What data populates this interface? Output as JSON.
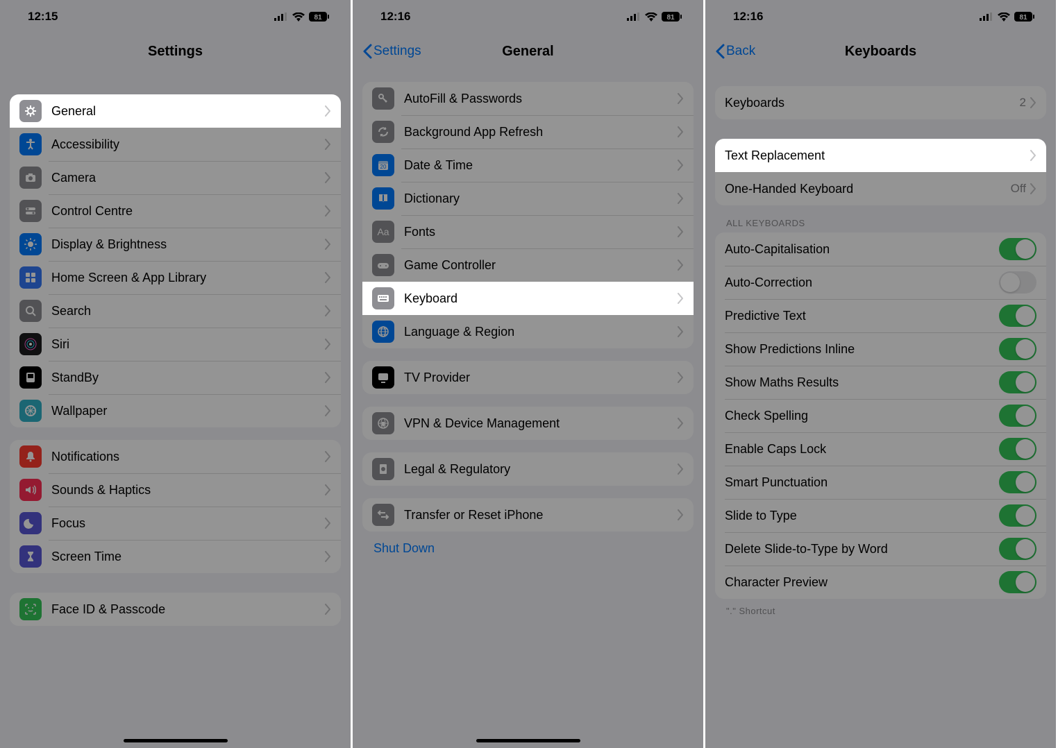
{
  "statusbar": {
    "time1": "12:15",
    "time2": "12:16",
    "time3": "12:16",
    "battery": "81"
  },
  "phone1": {
    "title": "Settings",
    "items_a": [
      {
        "label": "General",
        "icon": "gear",
        "bg": "#8e8e93",
        "highlight": true
      },
      {
        "label": "Accessibility",
        "icon": "accessibility",
        "bg": "#007aff"
      },
      {
        "label": "Camera",
        "icon": "camera",
        "bg": "#8e8e93"
      },
      {
        "label": "Control Centre",
        "icon": "switches",
        "bg": "#8e8e93"
      },
      {
        "label": "Display & Brightness",
        "icon": "brightness",
        "bg": "#007aff"
      },
      {
        "label": "Home Screen & App Library",
        "icon": "grid",
        "bg": "#3478f6"
      },
      {
        "label": "Search",
        "icon": "search",
        "bg": "#8e8e93"
      },
      {
        "label": "Siri",
        "icon": "siri",
        "bg": "#1c1c1e"
      },
      {
        "label": "StandBy",
        "icon": "standby",
        "bg": "#000000"
      },
      {
        "label": "Wallpaper",
        "icon": "wallpaper",
        "bg": "#30b0c7"
      }
    ],
    "items_b": [
      {
        "label": "Notifications",
        "icon": "bell",
        "bg": "#ff3b30"
      },
      {
        "label": "Sounds & Haptics",
        "icon": "speaker",
        "bg": "#ff2d55"
      },
      {
        "label": "Focus",
        "icon": "moon",
        "bg": "#5856d6"
      },
      {
        "label": "Screen Time",
        "icon": "hourglass",
        "bg": "#5856d6"
      }
    ],
    "items_c": [
      {
        "label": "Face ID & Passcode",
        "icon": "faceid",
        "bg": "#34c759"
      }
    ]
  },
  "phone2": {
    "back": "Settings",
    "title": "General",
    "items_a": [
      {
        "label": "AutoFill & Passwords",
        "icon": "key",
        "bg": "#8e8e93"
      },
      {
        "label": "Background App Refresh",
        "icon": "refresh",
        "bg": "#8e8e93"
      },
      {
        "label": "Date & Time",
        "icon": "calendar",
        "bg": "#007aff"
      },
      {
        "label": "Dictionary",
        "icon": "book",
        "bg": "#007aff"
      },
      {
        "label": "Fonts",
        "icon": "fonts",
        "bg": "#8e8e93"
      },
      {
        "label": "Game Controller",
        "icon": "controller",
        "bg": "#8e8e93"
      },
      {
        "label": "Keyboard",
        "icon": "keyboard",
        "bg": "#8e8e93",
        "highlight": true
      },
      {
        "label": "Language & Region",
        "icon": "globe",
        "bg": "#007aff"
      }
    ],
    "items_b": [
      {
        "label": "TV Provider",
        "icon": "tv",
        "bg": "#000000"
      }
    ],
    "items_c": [
      {
        "label": "VPN & Device Management",
        "icon": "vpn",
        "bg": "#8e8e93"
      }
    ],
    "items_d": [
      {
        "label": "Legal & Regulatory",
        "icon": "legal",
        "bg": "#8e8e93"
      }
    ],
    "items_e": [
      {
        "label": "Transfer or Reset iPhone",
        "icon": "transfer",
        "bg": "#8e8e93"
      }
    ],
    "shutdown": "Shut Down"
  },
  "phone3": {
    "back": "Back",
    "title": "Keyboards",
    "items_a": [
      {
        "label": "Keyboards",
        "value": "2"
      }
    ],
    "items_b": [
      {
        "label": "Text Replacement",
        "highlight": true
      },
      {
        "label": "One-Handed Keyboard",
        "value": "Off"
      }
    ],
    "section_header": "All Keyboards",
    "toggles": [
      {
        "label": "Auto-Capitalisation",
        "on": true
      },
      {
        "label": "Auto-Correction",
        "on": false
      },
      {
        "label": "Predictive Text",
        "on": true
      },
      {
        "label": "Show Predictions Inline",
        "on": true
      },
      {
        "label": "Show Maths Results",
        "on": true
      },
      {
        "label": "Check Spelling",
        "on": true
      },
      {
        "label": "Enable Caps Lock",
        "on": true
      },
      {
        "label": "Smart Punctuation",
        "on": true
      },
      {
        "label": "Slide to Type",
        "on": true
      },
      {
        "label": "Delete Slide-to-Type by Word",
        "on": true
      },
      {
        "label": "Character Preview",
        "on": true
      }
    ],
    "shortcut_hint": "\".\" Shortcut"
  }
}
